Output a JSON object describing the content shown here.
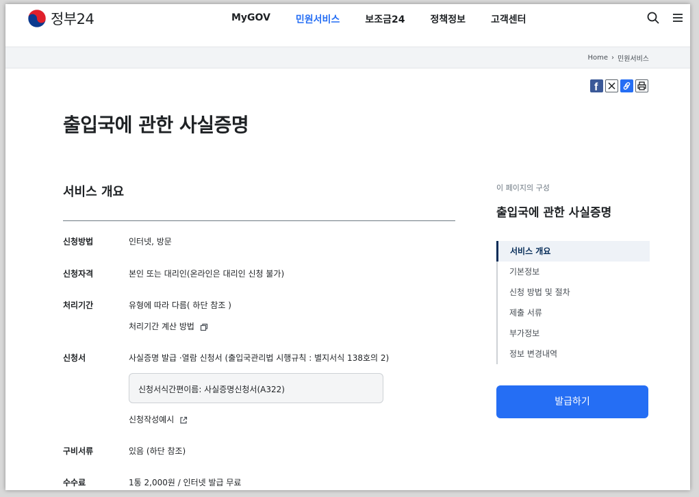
{
  "header": {
    "logo_text": "정부24",
    "nav": [
      {
        "label": "MyGOV"
      },
      {
        "label": "민원서비스",
        "active": true
      },
      {
        "label": "보조금24"
      },
      {
        "label": "정책정보"
      },
      {
        "label": "고객센터"
      }
    ],
    "icons": [
      "search-icon",
      "menu-icon"
    ]
  },
  "breadcrumb": {
    "home": "Home",
    "current": "민원서비스"
  },
  "share_icons": [
    "facebook-icon",
    "x-icon",
    "link-icon",
    "print-icon"
  ],
  "page_title": "출입국에 관한 사실증명",
  "section_title": "서비스 개요",
  "rows": {
    "method": {
      "label": "신청방법",
      "value": "인터넷, 방문"
    },
    "eligibility": {
      "label": "신청자격",
      "value": "본인 또는 대리인(온라인은 대리인 신청 불가)"
    },
    "period": {
      "label": "처리기간",
      "value": "유형에 따라 다름( 하단 참조 )",
      "link": "처리기간 계산 방법"
    },
    "form": {
      "label": "신청서",
      "value": "사실증명 발급 ·열람 신청서 (출입국관리법 시행규칙 : 별지서식 138호의 2)",
      "box": "신청서식간편이름: 사실증명신청서(A322)",
      "link": "신청작성예시"
    },
    "docs": {
      "label": "구비서류",
      "value": "있음 (하단 참조)"
    },
    "fee": {
      "label": "수수료",
      "value": "1통 2,000원 / 인터넷 발급 무료"
    }
  },
  "aside": {
    "caption": "이 페이지의 구성",
    "title": "출입국에 관한 사실증명",
    "toc": [
      "서비스 개요",
      "기본정보",
      "신청 방법 및 절차",
      "제출 서류",
      "부가정보",
      "정보 변경내역"
    ],
    "button": "발급하기"
  },
  "colors": {
    "accent": "#256ef4",
    "active_toc": "#052b57"
  }
}
